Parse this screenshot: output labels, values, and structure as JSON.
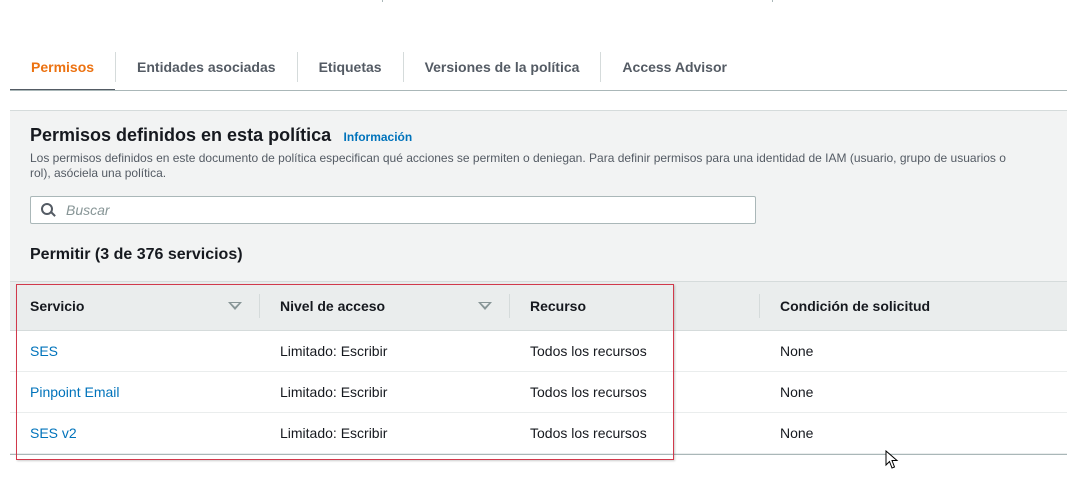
{
  "tabs": [
    {
      "label": "Permisos",
      "active": true
    },
    {
      "label": "Entidades asociadas",
      "active": false
    },
    {
      "label": "Etiquetas",
      "active": false
    },
    {
      "label": "Versiones de la política",
      "active": false
    },
    {
      "label": "Access Advisor",
      "active": false
    }
  ],
  "panel": {
    "title": "Permisos definidos en esta política",
    "info_link": "Información",
    "description": "Los permisos definidos en este documento de política especifican qué acciones se permiten o deniegan. Para definir permisos para una identidad de IAM (usuario, grupo de usuarios o rol), asóciela una política.",
    "search": {
      "placeholder": "Buscar",
      "value": ""
    },
    "section_title": "Permitir (3 de 376 servicios)"
  },
  "table": {
    "columns": [
      "Servicio",
      "Nivel de acceso",
      "Recurso",
      "Condición de solicitud"
    ],
    "rows": [
      {
        "service": "SES",
        "access_level": "Limitado: Escribir",
        "resource": "Todos los recursos",
        "condition": "None"
      },
      {
        "service": "Pinpoint Email",
        "access_level": "Limitado: Escribir",
        "resource": "Todos los recursos",
        "condition": "None"
      },
      {
        "service": "SES v2",
        "access_level": "Limitado: Escribir",
        "resource": "Todos los recursos",
        "condition": "None"
      }
    ]
  },
  "colors": {
    "active_tab": "#ec7211",
    "link": "#0073bb",
    "highlight_box": "#d1394b"
  }
}
